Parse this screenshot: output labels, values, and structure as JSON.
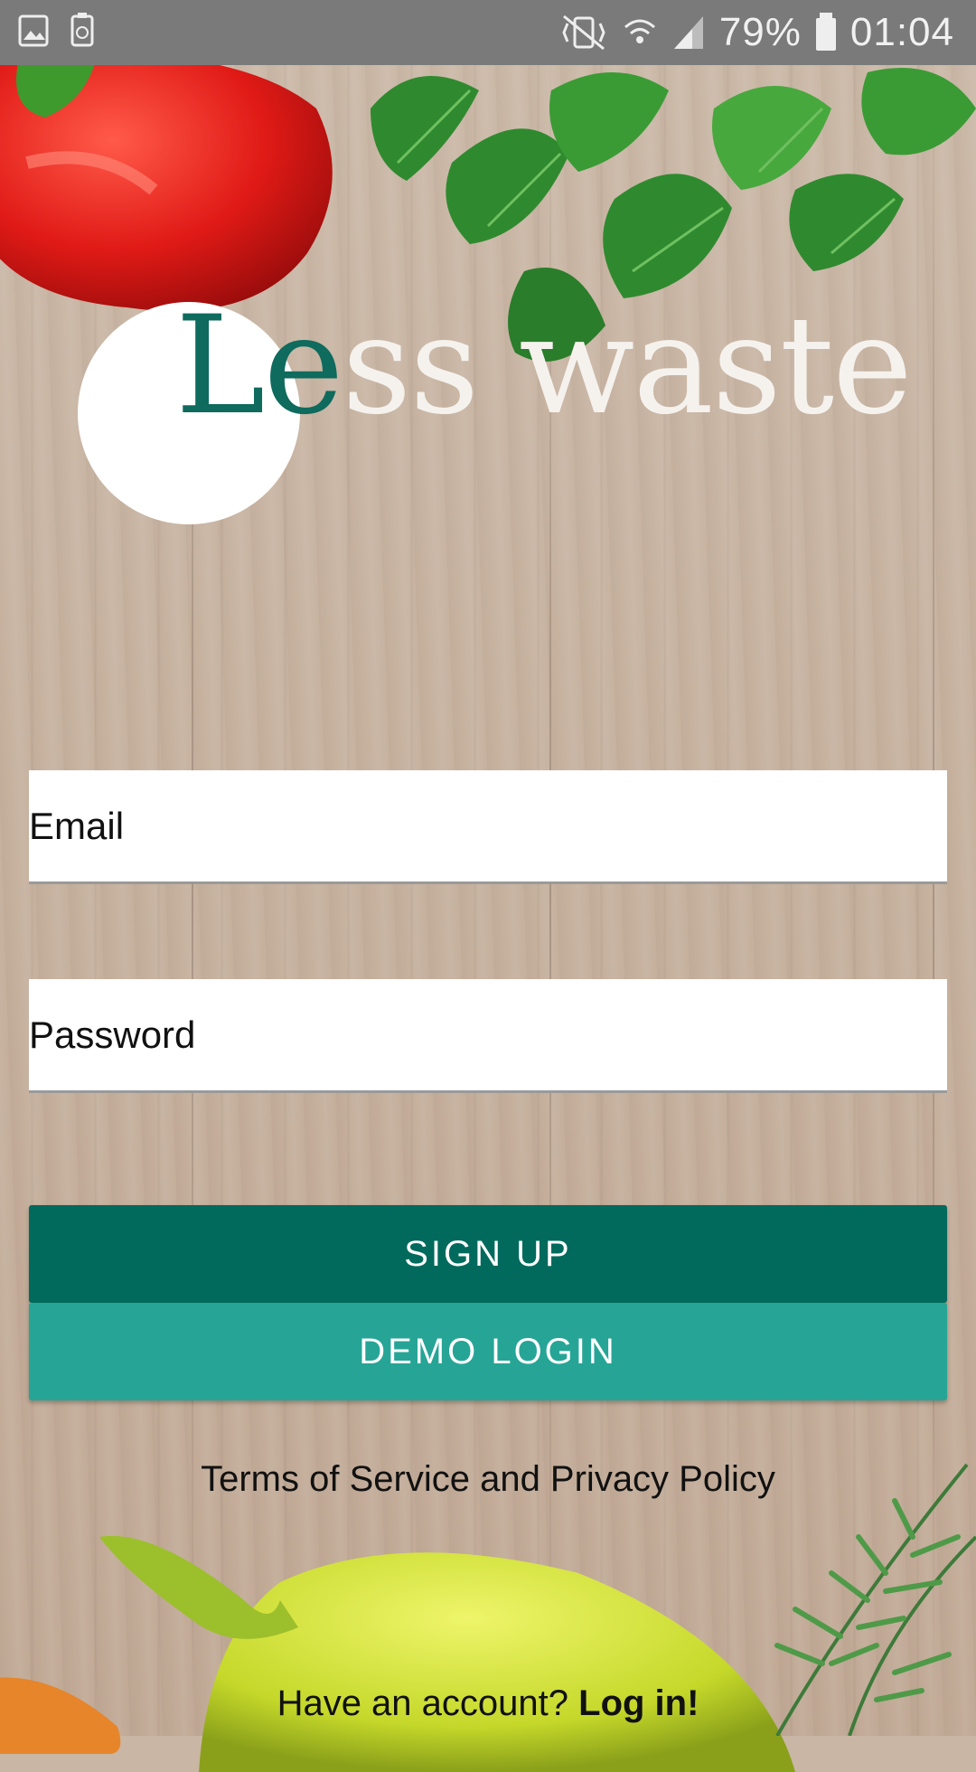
{
  "status_bar": {
    "battery": "79%",
    "time": "01:04",
    "icons": [
      "gallery-icon",
      "recycle-icon",
      "mute-vibrate-icon",
      "wifi-icon",
      "signal-icon",
      "battery-icon"
    ]
  },
  "logo": {
    "green_part": "Le",
    "white_part": "ss waste"
  },
  "form": {
    "email_placeholder": "Email",
    "password_placeholder": "Password"
  },
  "buttons": {
    "signup": "SIGN UP",
    "demo_login": "DEMO LOGIN"
  },
  "links": {
    "terms": "Terms of Service and Privacy Policy",
    "have_account": "Have an account?",
    "login": "Log in!"
  },
  "colors": {
    "primary": "#016a5c",
    "secondary": "#26a596",
    "logo_green": "#0e6b5d"
  }
}
